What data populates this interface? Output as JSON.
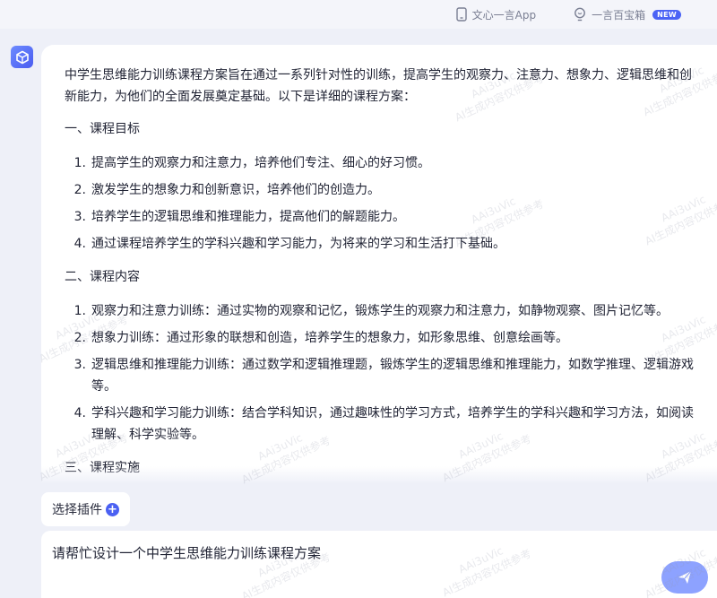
{
  "topbar": {
    "app_link": "文心一言App",
    "treasure_link": "一言百宝箱",
    "badge": "NEW"
  },
  "answer": {
    "intro": "中学生思维能力训练课程方案旨在通过一系列针对性的训练，提高学生的观察力、注意力、想象力、逻辑思维和创新能力，为他们的全面发展奠定基础。以下是详细的课程方案：",
    "sections": [
      {
        "title": "一、课程目标",
        "items": [
          {
            "num": "1.",
            "text": "提高学生的观察力和注意力，培养他们专注、细心的好习惯。"
          },
          {
            "num": "2.",
            "text": "激发学生的想象力和创新意识，培养他们的创造力。"
          },
          {
            "num": "3.",
            "text": "培养学生的逻辑思维和推理能力，提高他们的解题能力。"
          },
          {
            "num": "4.",
            "text": "通过课程培养学生的学科兴趣和学习能力，为将来的学习和生活打下基础。"
          }
        ]
      },
      {
        "title": "二、课程内容",
        "items": [
          {
            "num": "1.",
            "text": "观察力和注意力训练：通过实物的观察和记忆，锻炼学生的观察力和注意力，如静物观察、图片记忆等。"
          },
          {
            "num": "2.",
            "text": "想象力训练：通过形象的联想和创造，培养学生的想象力，如形象思维、创意绘画等。"
          },
          {
            "num": "3.",
            "text": "逻辑思维和推理能力训练：通过数学和逻辑推理题，锻炼学生的逻辑思维和推理能力，如数学推理、逻辑游戏等。"
          },
          {
            "num": "4.",
            "text": "学科兴趣和学习能力训练：结合学科知识，通过趣味性的学习方式，培养学生的学科兴趣和学习方法，如阅读理解、科学实验等。"
          }
        ]
      },
      {
        "title": "三、课程实施",
        "items": []
      }
    ]
  },
  "plugin_button": "选择插件",
  "input": {
    "value": "请帮忙设计一个中学生思维能力训练课程方案"
  },
  "watermark": {
    "line1": "AAi3uVic",
    "line2": "AI生成内容仅供参考"
  },
  "colors": {
    "accent": "#4a60f2",
    "send_button": "#8da2ff",
    "background": "#eef0f8"
  }
}
